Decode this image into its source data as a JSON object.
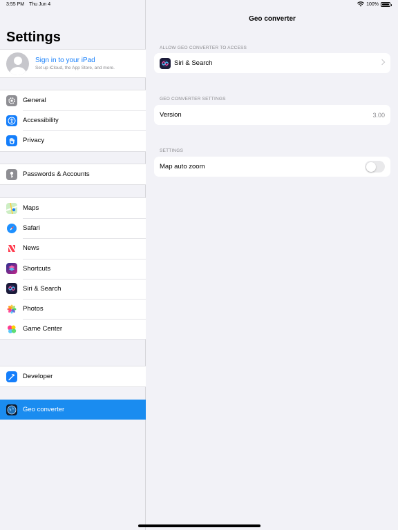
{
  "status_bar": {
    "time": "3:55 PM",
    "date": "Thu Jun 4",
    "battery": "100%"
  },
  "sidebar": {
    "title": "Settings",
    "account": {
      "title": "Sign in to your iPad",
      "subtitle": "Set up iCloud, the App Store, and more."
    },
    "groups": [
      {
        "items": [
          {
            "label": "General",
            "icon": "gear-icon",
            "color": "#8e8e93"
          },
          {
            "label": "Accessibility",
            "icon": "accessibility-icon",
            "color": "#147efb"
          },
          {
            "label": "Privacy",
            "icon": "hand-icon",
            "color": "#147efb"
          }
        ]
      },
      {
        "items": [
          {
            "label": "Passwords & Accounts",
            "icon": "key-icon",
            "color": "#8e8e93"
          }
        ]
      },
      {
        "items": [
          {
            "label": "Maps",
            "icon": "maps-icon",
            "color": "#6fd36a"
          },
          {
            "label": "Safari",
            "icon": "compass-icon",
            "color": "#1e90ff"
          },
          {
            "label": "News",
            "icon": "news-icon",
            "color": "#ff3b4e"
          },
          {
            "label": "Shortcuts",
            "icon": "shortcuts-icon",
            "color": "#5b3bd6"
          },
          {
            "label": "Siri & Search",
            "icon": "siri-icon",
            "color": "#222244"
          },
          {
            "label": "Photos",
            "icon": "photos-icon",
            "color": "#ffffff"
          },
          {
            "label": "Game Center",
            "icon": "game-center-icon",
            "color": "#ffffff"
          }
        ]
      },
      {
        "items": [
          {
            "label": "Developer",
            "icon": "hammer-icon",
            "color": "#147efb"
          }
        ]
      },
      {
        "items": [
          {
            "label": "Geo converter",
            "icon": "globe-icon",
            "color": "#0c1a2e",
            "selected": true
          }
        ]
      }
    ]
  },
  "detail": {
    "title": "Geo converter",
    "sections": [
      {
        "header": "ALLOW GEO CONVERTER TO ACCESS",
        "row": {
          "label": "Siri & Search",
          "icon": "siri-icon"
        }
      },
      {
        "header": "GEO CONVERTER SETTINGS",
        "row": {
          "label": "Version",
          "value": "3.00"
        }
      },
      {
        "header": "SETTINGS",
        "row": {
          "label": "Map auto zoom",
          "toggle": false
        }
      }
    ]
  }
}
